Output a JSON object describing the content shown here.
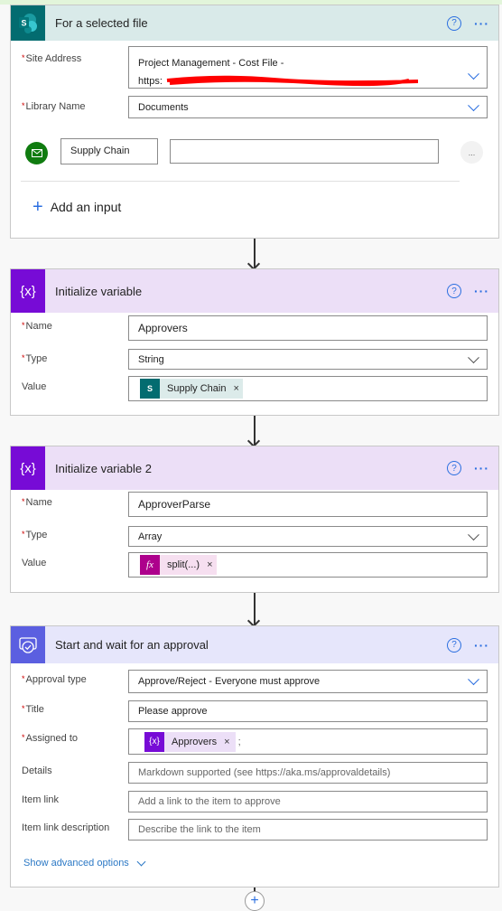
{
  "trigger": {
    "title": "For a selected file",
    "help_icon": "question-circle-icon",
    "more_icon": "ellipsis-icon",
    "site_address_label": "Site Address",
    "site_address_line1": "Project Management - Cost File -",
    "site_address_line2": "https:",
    "library_name_label": "Library Name",
    "library_name_value": "Documents",
    "input_name": "Supply Chain",
    "input_value": "",
    "input_more": "...",
    "add_input_label": "Add an input",
    "header_color": "#d9eae9",
    "icon_color": "#036c70"
  },
  "var1": {
    "title": "Initialize variable",
    "name_label": "Name",
    "name_value": "Approvers",
    "type_label": "Type",
    "type_value": "String",
    "value_label": "Value",
    "value_token": "Supply Chain",
    "header_color": "#ecdff7",
    "icon_color": "#770bd6"
  },
  "var2": {
    "title": "Initialize variable 2",
    "name_label": "Name",
    "name_value": "ApproverParse",
    "type_label": "Type",
    "type_value": "Array",
    "value_label": "Value",
    "value_token": "split(...)",
    "fx": "fx"
  },
  "approval": {
    "title": "Start and wait for an approval",
    "approval_type_label": "Approval type",
    "approval_type_value": "Approve/Reject - Everyone must approve",
    "title_label": "Title",
    "title_value": "Please approve",
    "assigned_label": "Assigned to",
    "assigned_token": "Approvers",
    "assigned_suffix": ";",
    "details_label": "Details",
    "details_placeholder": "Markdown supported (see https://aka.ms/approvaldetails)",
    "item_link_label": "Item link",
    "item_link_placeholder": "Add a link to the item to approve",
    "item_link_desc_label": "Item link description",
    "item_link_desc_placeholder": "Describe the link to the item",
    "show_advanced": "Show advanced options",
    "header_color": "#e6e6fb",
    "icon_color": "#5b5fe0"
  },
  "var_icon": "{x}",
  "help": "?",
  "more": "···",
  "asterisk": "*",
  "remove": "×"
}
